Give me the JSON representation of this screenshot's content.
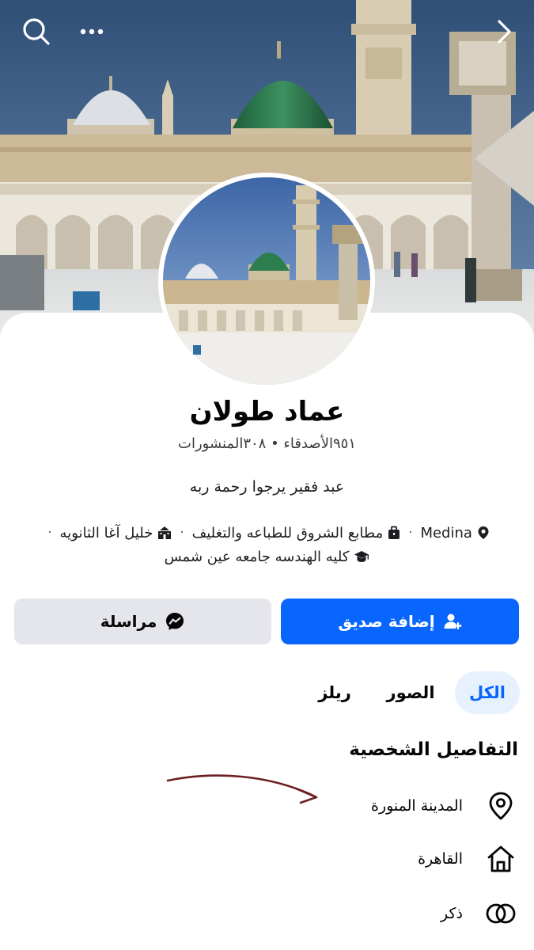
{
  "header": {
    "search_icon": "search-icon",
    "more_icon": "more-horizontal-icon",
    "forward_icon": "chevron-right-icon"
  },
  "profile": {
    "name": "عماد طولان",
    "stats": "٩٥١الأصدقاء • ٣٠٨المنشورات",
    "bio": "عبد فقير يرجوا رحمة ربه",
    "meta": {
      "location": "Medina",
      "work": "مطابع الشروق للطباعه والتغليف",
      "school": "خليل آغا الثانويه",
      "college": "كليه الهندسه جامعه عين شمس"
    }
  },
  "actions": {
    "add_friend": "إضافة صديق",
    "message": "مراسلة"
  },
  "tabs": [
    "الكل",
    "الصور",
    "ريلز"
  ],
  "details": {
    "title": "التفاصيل الشخصية",
    "items": [
      {
        "icon": "location-pin-icon",
        "text": "المدينة المنورة"
      },
      {
        "icon": "home-icon",
        "text": "القاهرة"
      },
      {
        "icon": "gender-icon",
        "text": "ذكر"
      }
    ]
  },
  "colors": {
    "accent": "#0866ff",
    "tab_active_bg": "#e7f0fd",
    "secondary_button": "#e4e6eb",
    "annotation_arrow": "#6b1f22"
  }
}
